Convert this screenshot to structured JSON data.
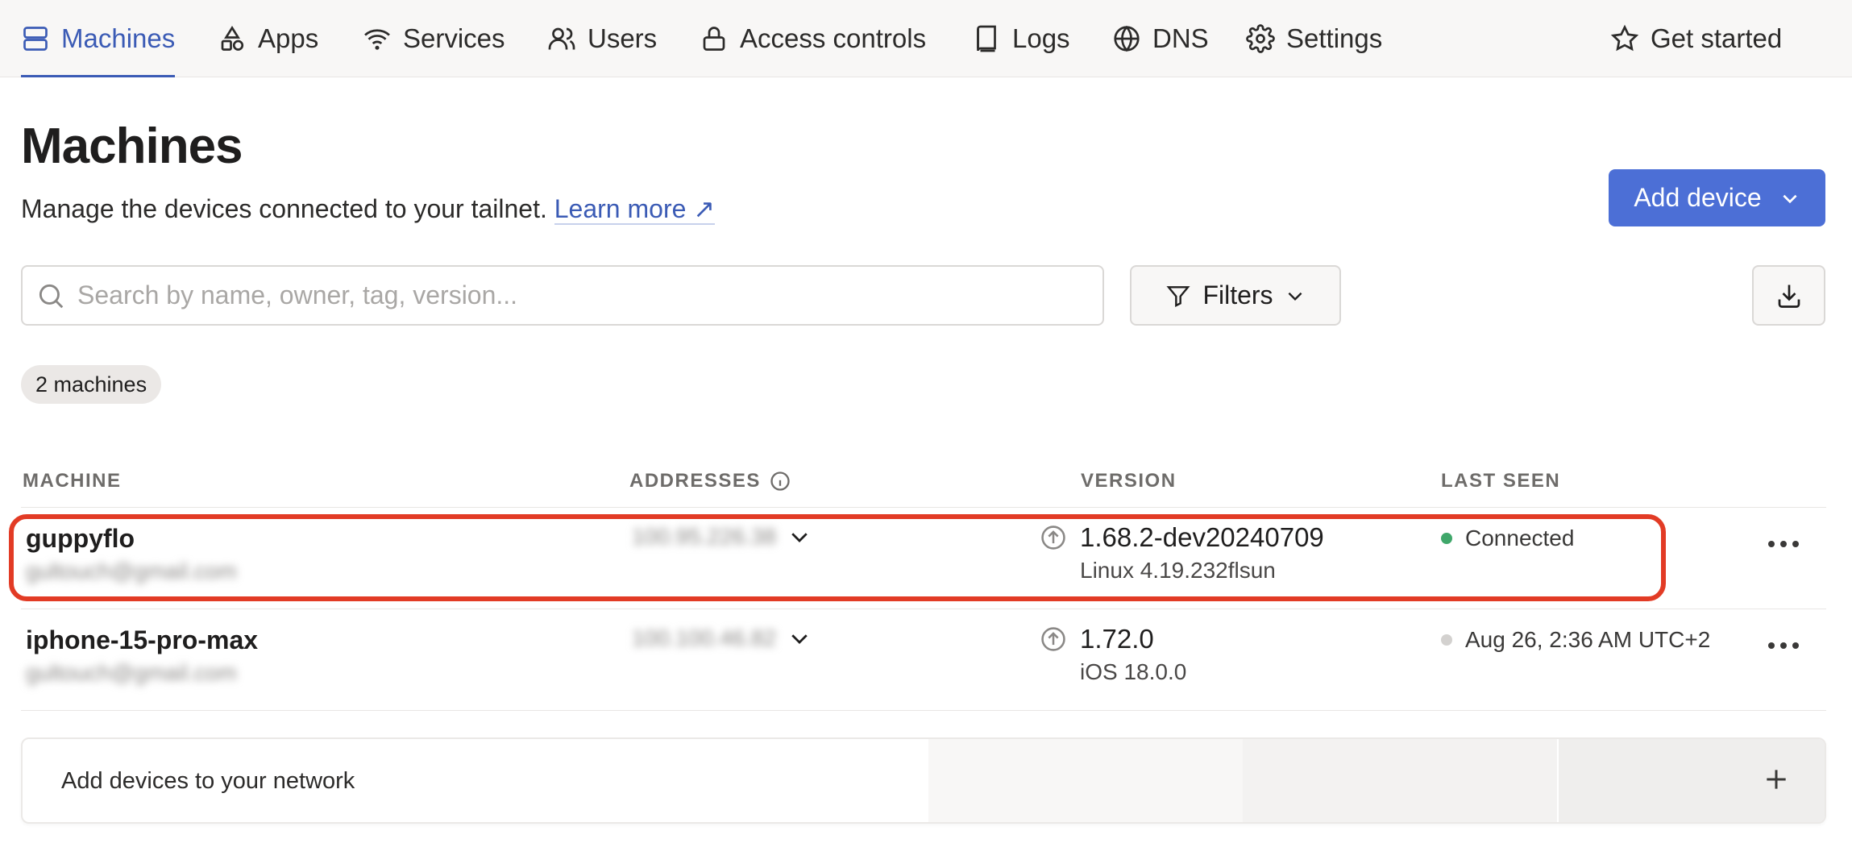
{
  "nav": {
    "items": [
      {
        "label": "Machines",
        "icon": "server-icon"
      },
      {
        "label": "Apps",
        "icon": "shapes-icon"
      },
      {
        "label": "Services",
        "icon": "wifi-icon"
      },
      {
        "label": "Users",
        "icon": "users-icon"
      },
      {
        "label": "Access controls",
        "icon": "lock-icon"
      },
      {
        "label": "Logs",
        "icon": "book-icon"
      },
      {
        "label": "DNS",
        "icon": "globe-icon"
      },
      {
        "label": "Settings",
        "icon": "gear-icon"
      }
    ],
    "active": "Machines",
    "get_started": "Get started"
  },
  "header": {
    "title": "Machines",
    "subtitle": "Manage the devices connected to your tailnet.",
    "learn_more": "Learn more ↗",
    "add_device": "Add device"
  },
  "toolbar": {
    "search_placeholder": "Search by name, owner, tag, version...",
    "filters": "Filters"
  },
  "count": "2 machines",
  "table": {
    "headers": [
      "MACHINE",
      "ADDRESSES",
      "VERSION",
      "LAST SEEN"
    ],
    "rows": [
      {
        "name": "guppyflo",
        "owner": "gultouch@gmail.com",
        "address": "100.95.226.38",
        "version": "1.68.2-dev20240709",
        "os": "Linux 4.19.232flsun",
        "last_seen": "Connected",
        "status_color": "#3fa76a",
        "update_available": true
      },
      {
        "name": "iphone-15-pro-max",
        "owner": "gultouch@gmail.com",
        "address": "100.100.46.82",
        "version": "1.72.0",
        "os": "iOS 18.0.0",
        "last_seen": "Aug 26, 2:36 AM UTC+2",
        "status_color": "#d3d1cf",
        "update_available": true
      }
    ]
  },
  "banner": {
    "text": "Add devices to your network"
  },
  "colors": {
    "accent": "#3b5bb5",
    "button": "#4c6fd6",
    "highlight": "#e23b25"
  }
}
